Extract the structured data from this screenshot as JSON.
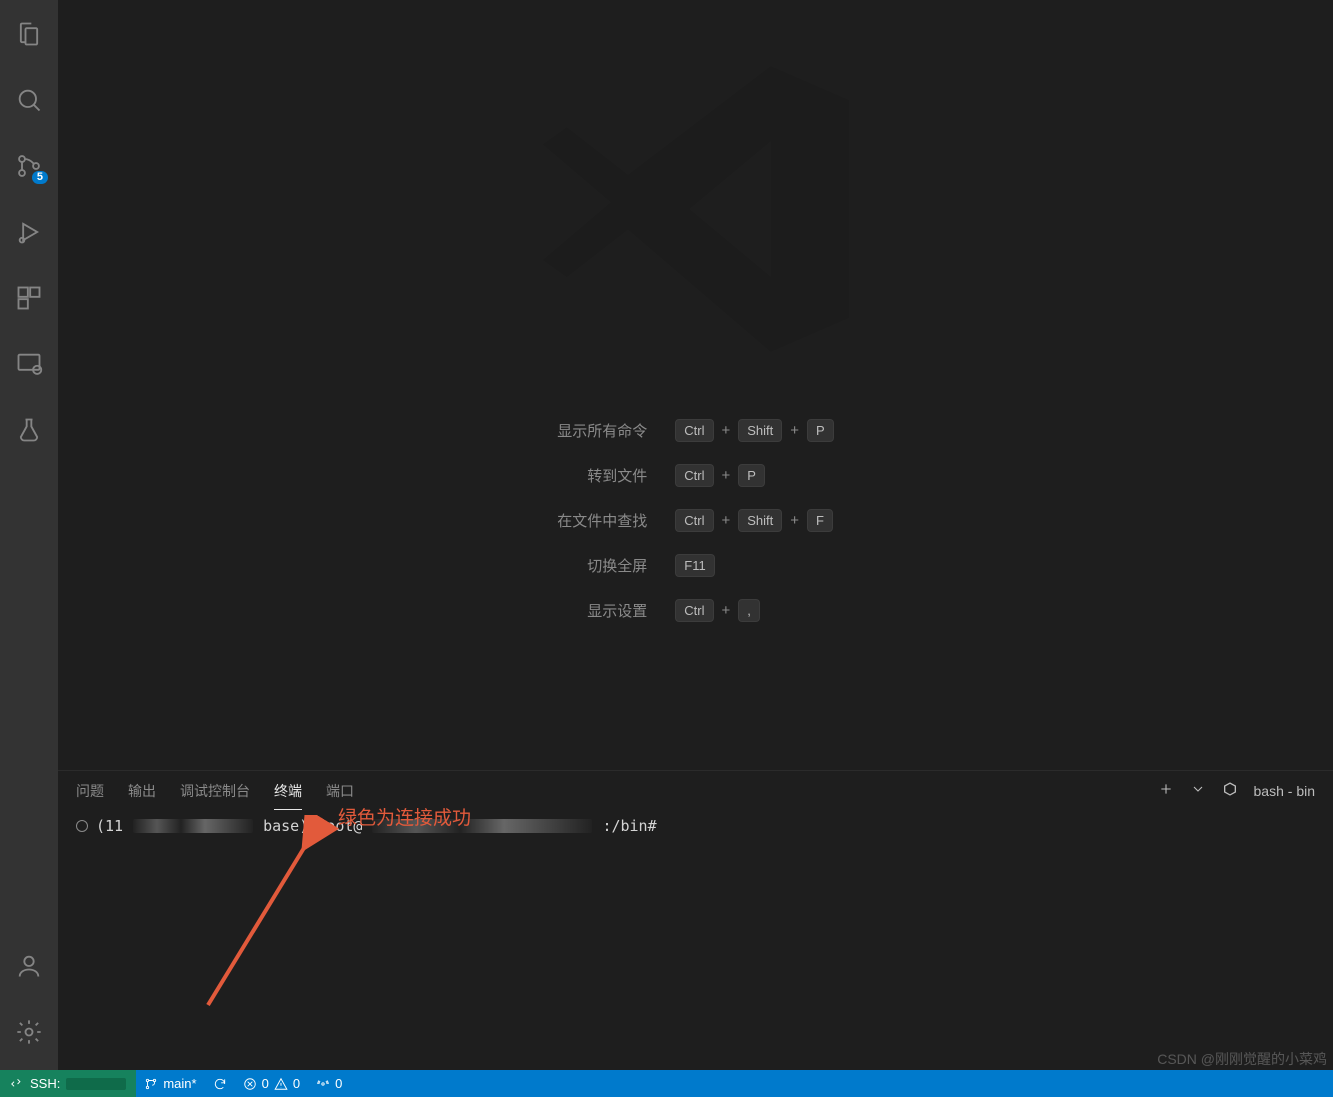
{
  "activity": {
    "scm_badge": "5"
  },
  "welcome": {
    "hints": [
      {
        "label": "显示所有命令",
        "keys": [
          "Ctrl",
          "Shift",
          "P"
        ]
      },
      {
        "label": "转到文件",
        "keys": [
          "Ctrl",
          "P"
        ]
      },
      {
        "label": "在文件中查找",
        "keys": [
          "Ctrl",
          "Shift",
          "F"
        ]
      },
      {
        "label": "切换全屏",
        "keys": [
          "F11"
        ]
      },
      {
        "label": "显示设置",
        "keys": [
          "Ctrl",
          ","
        ]
      }
    ]
  },
  "panel": {
    "tabs": {
      "problems": "问题",
      "output": "输出",
      "debug": "调试控制台",
      "terminal": "终端",
      "ports": "端口"
    },
    "shell_label": "bash - bin",
    "terminal_line_visible": ":/bin#",
    "terminal_prefix_hint_left": "(11",
    "terminal_prefix_hint_mid": "base)  root@",
    "annotation_text": "绿色为连接成功"
  },
  "statusbar": {
    "remote_label_prefix": "SSH:",
    "branch": "main*",
    "errors": "0",
    "warnings": "0",
    "ports": "0"
  },
  "watermark": "CSDN @刚刚觉醒的小菜鸡"
}
